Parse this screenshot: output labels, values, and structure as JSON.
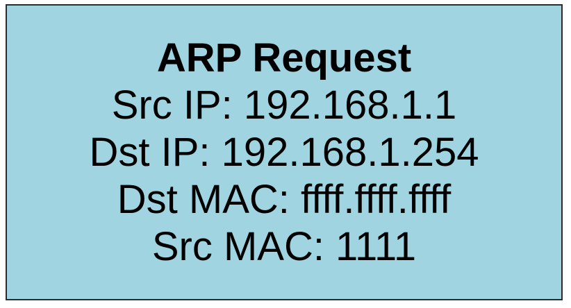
{
  "packet": {
    "title": "ARP Request",
    "src_ip": "Src IP: 192.168.1.1",
    "dst_ip": "Dst IP: 192.168.1.254",
    "dst_mac": "Dst MAC: ffff.ffff.ffff",
    "src_mac": "Src MAC: 1111"
  },
  "colors": {
    "box_fill": "#9fd4e0",
    "box_border": "#2b2b2b",
    "text": "#000000"
  }
}
